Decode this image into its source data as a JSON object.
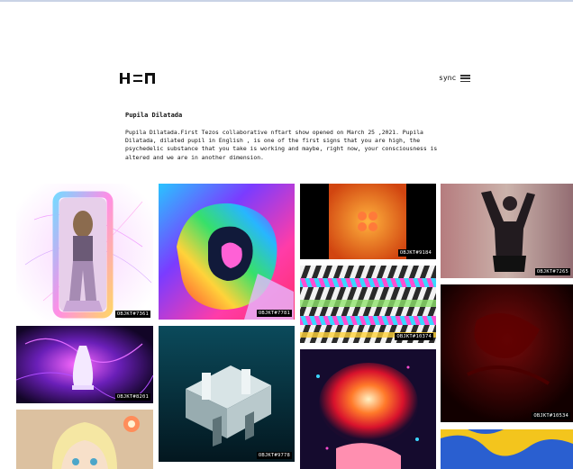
{
  "header": {
    "sync_label": "sync"
  },
  "exhibition": {
    "title": "Pupila Dilatada",
    "description": "Pupila Dilatada.First Tezos collaborative nftart show opened on March 25 ,2021. Pupila\nDilatada, dilated pupil in English , is one of the first signs that you are high, the\npsychedelic substance that you take is working and maybe, right now, your consciousness is\naltered and we are in another dimension."
  },
  "gallery": {
    "items": [
      {
        "label": "OBJKT#7361"
      },
      {
        "label": "OBJKT#7781"
      },
      {
        "label": "OBJKT#9184"
      },
      {
        "label": "OBJKT#7265"
      },
      {
        "label": "OBJKT#8201"
      },
      {
        "label": "OBJKT#9778"
      },
      {
        "label": "OBJKT#10374"
      },
      {
        "label": "OBJKT#10534"
      },
      {
        "label": ""
      },
      {
        "label": ""
      },
      {
        "label": ""
      }
    ]
  },
  "colors": {
    "background": "#ffffff",
    "text": "#111111",
    "badge_bg": "#000000",
    "badge_text": "#ffffff"
  },
  "icons": {
    "menu": "hamburger-icon"
  }
}
